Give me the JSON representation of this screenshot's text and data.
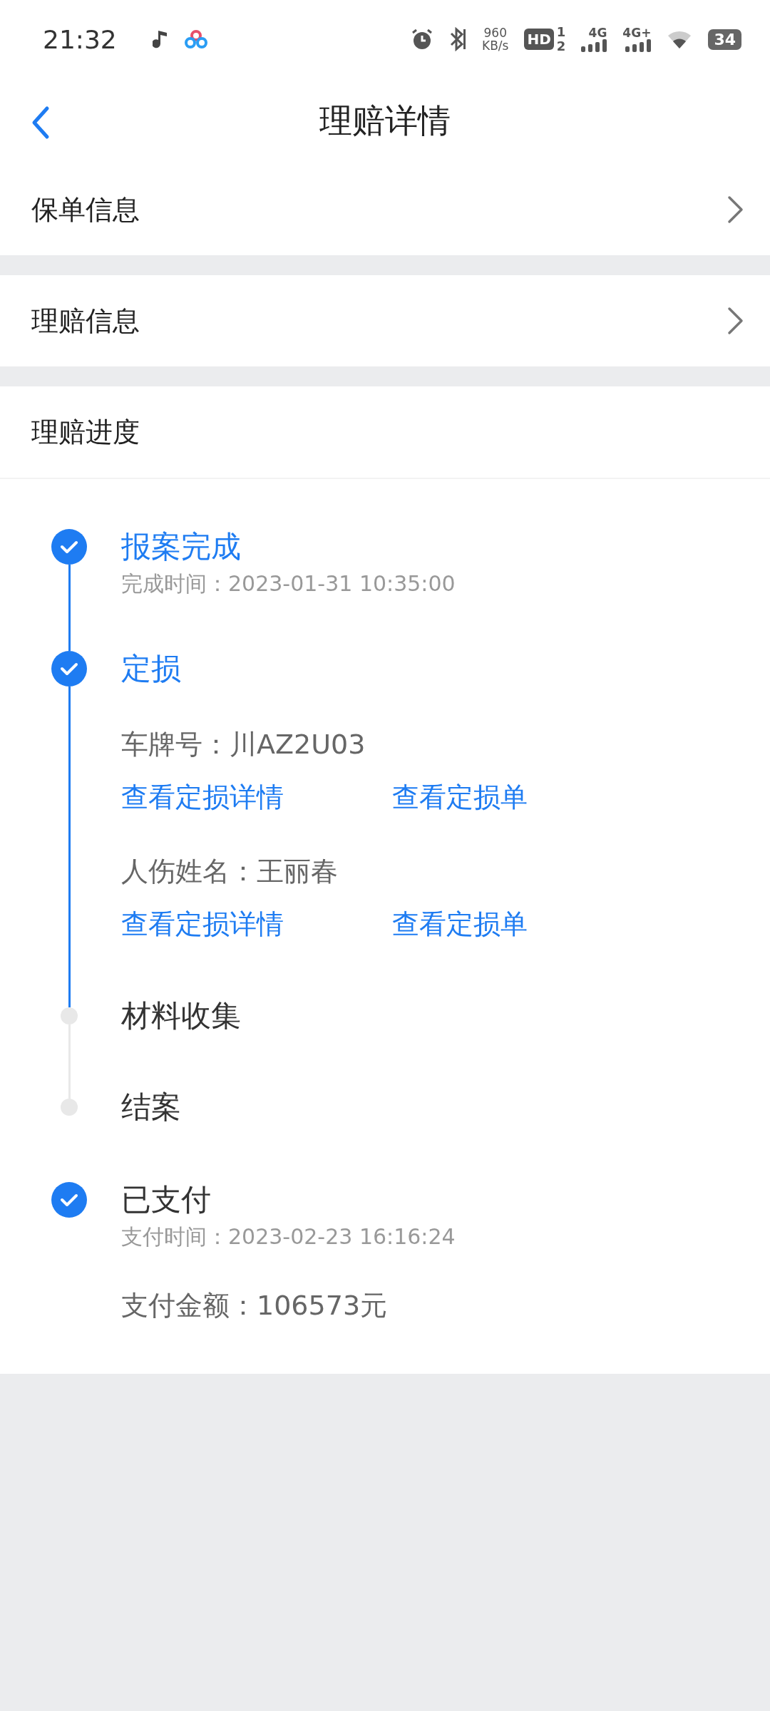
{
  "status_bar": {
    "time": "21:32",
    "net_speed": "960",
    "net_unit": "KB/s",
    "hd": "HD",
    "sim_1": "1",
    "sim_2": "2",
    "signal_1": "4G",
    "signal_2": "4G+",
    "battery": "34"
  },
  "header": {
    "title": "理赔详情"
  },
  "nav_rows": [
    {
      "label": "保单信息"
    },
    {
      "label": "理赔信息"
    }
  ],
  "progress": {
    "title": "理赔进度",
    "steps": [
      {
        "title": "报案完成",
        "done": true,
        "highlighted": true,
        "time": "完成时间：2023-01-31 10:35:00"
      },
      {
        "title": "定损",
        "done": true,
        "highlighted": true,
        "items": [
          {
            "label": "车牌号：川AZ2U03",
            "links": [
              "查看定损详情",
              "查看定损单"
            ]
          },
          {
            "label": "人伤姓名：王丽春",
            "links": [
              "查看定损详情",
              "查看定损单"
            ]
          }
        ]
      },
      {
        "title": "材料收集",
        "done": false,
        "highlighted": false
      },
      {
        "title": "结案",
        "done": false,
        "highlighted": false
      }
    ],
    "payment": {
      "title": "已支付",
      "done": true,
      "time": "支付时间：2023-02-23 16:16:24",
      "amount": "支付金额：106573元"
    }
  }
}
